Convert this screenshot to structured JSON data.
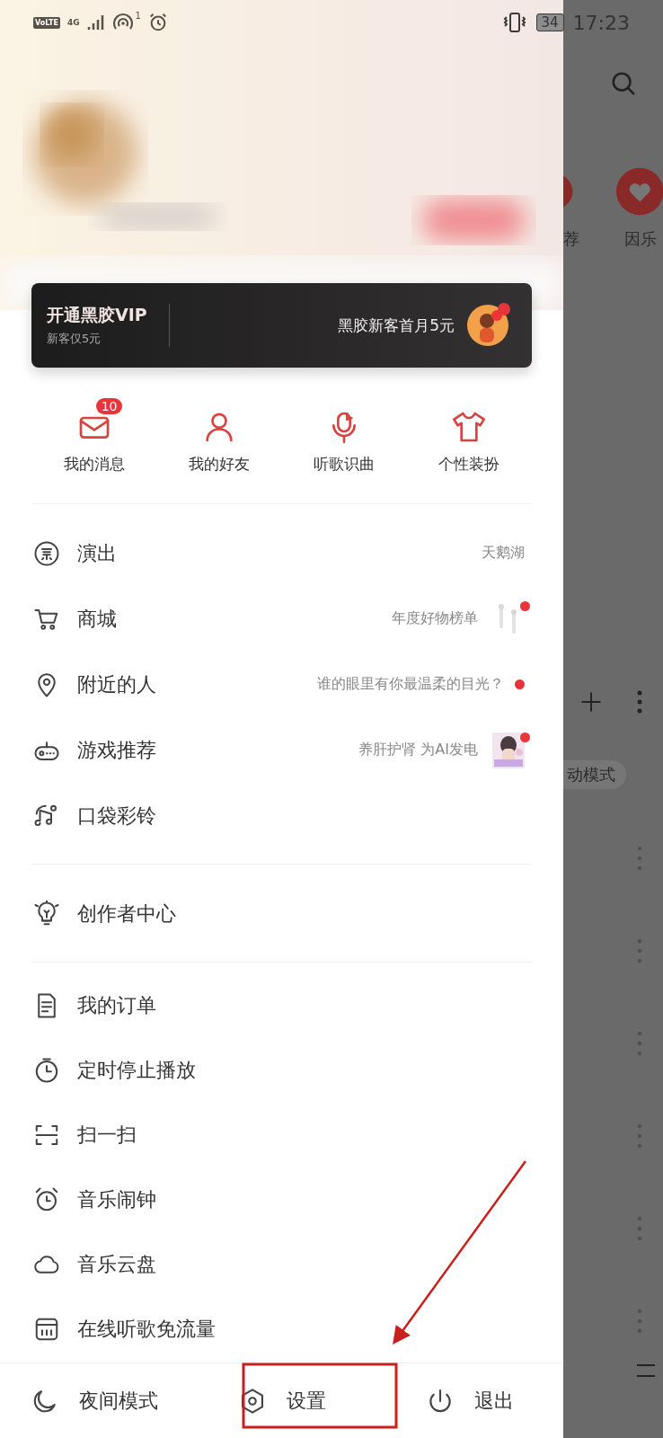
{
  "status_bar": {
    "volte": "VoLTE",
    "network": "4G",
    "hotspot_count": "1",
    "battery": "34",
    "time": "17:23"
  },
  "vip_card": {
    "title": "开通黑胶VIP",
    "subtitle": "新客仅5元",
    "promo": "黑胶新客首月5元",
    "dot": true
  },
  "quick_actions": [
    {
      "label": "我的消息",
      "badge": "10"
    },
    {
      "label": "我的好友"
    },
    {
      "label": "听歌识曲"
    },
    {
      "label": "个性装扮"
    }
  ],
  "menu_sections": [
    [
      {
        "label": "演出",
        "hint": "天鹅湖",
        "kind": "text",
        "dot": false
      },
      {
        "label": "商城",
        "hint": "年度好物榜单",
        "kind": "thumb",
        "dot": true
      },
      {
        "label": "附近的人",
        "hint": "谁的眼里有你最温柔的目光？",
        "kind": "text",
        "dot": true
      },
      {
        "label": "游戏推荐",
        "hint": "养肝护肾 为AI发电",
        "kind": "thumb",
        "dot": true
      },
      {
        "label": "口袋彩铃",
        "kind": "text",
        "dot": false
      }
    ],
    [
      {
        "label": "创作者中心",
        "kind": "text",
        "dot": false
      }
    ],
    [
      {
        "label": "我的订单",
        "kind": "text",
        "dot": false
      },
      {
        "label": "定时停止播放",
        "kind": "text",
        "dot": false
      },
      {
        "label": "扫一扫",
        "kind": "text",
        "dot": false
      },
      {
        "label": "音乐闹钟",
        "kind": "text",
        "dot": false
      },
      {
        "label": "音乐云盘",
        "kind": "text",
        "dot": false
      },
      {
        "label": "在线听歌免流量",
        "kind": "text",
        "dot": false
      }
    ]
  ],
  "footer": [
    {
      "label": "夜间模式",
      "highlighted": false
    },
    {
      "label": "设置",
      "highlighted": true
    },
    {
      "label": "退出",
      "highlighted": false
    }
  ],
  "background": {
    "tabs": [
      "荐",
      "因乐"
    ],
    "chip": "动模式"
  }
}
